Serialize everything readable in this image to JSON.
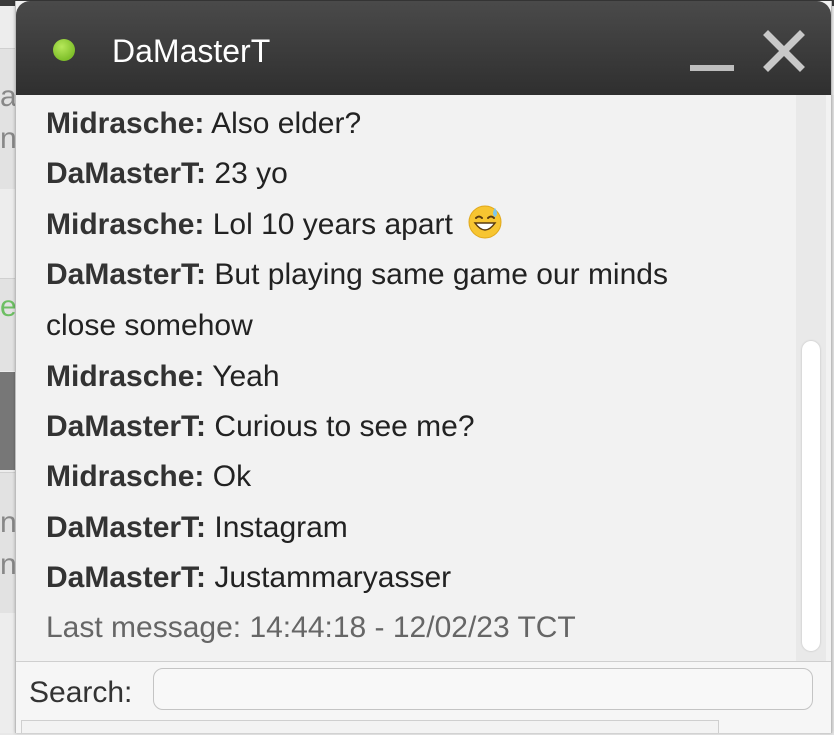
{
  "window": {
    "title": "DaMasterT",
    "status_color": "#7fbf2a",
    "minimize_icon": "minimize-icon",
    "close_icon": "close-icon"
  },
  "messages": [
    {
      "sender": "Midrasche:",
      "text": "Also elder?"
    },
    {
      "sender": "DaMasterT:",
      "text": "23 yo"
    },
    {
      "sender": "Midrasche:",
      "text": "Lol 10 years apart",
      "emoji": "grinning-sweat-emoji"
    },
    {
      "sender": "DaMasterT:",
      "text": "But playing same game our minds"
    },
    {
      "sender": "",
      "text": "close somehow"
    },
    {
      "sender": "Midrasche:",
      "text": "Yeah"
    },
    {
      "sender": "DaMasterT:",
      "text": "Curious to see me?"
    },
    {
      "sender": "Midrasche:",
      "text": "Ok"
    },
    {
      "sender": "DaMasterT:",
      "text": "Instagram"
    },
    {
      "sender": "DaMasterT:",
      "text": "Justammaryasser"
    }
  ],
  "last_message": "Last message: 14:44:18 - 12/02/23 TCT",
  "search": {
    "label": "Search:",
    "value": "",
    "placeholder": ""
  },
  "background": {
    "letters": [
      "a",
      "n",
      "e",
      "n",
      "n"
    ]
  }
}
